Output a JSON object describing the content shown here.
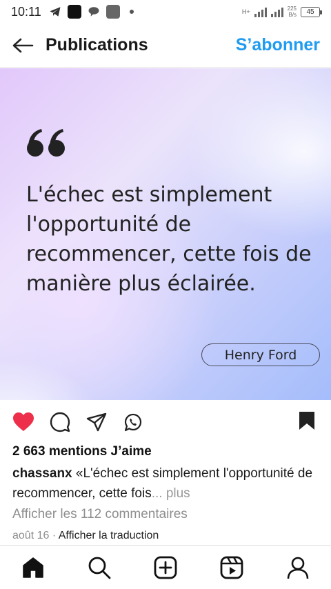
{
  "status_bar": {
    "time": "10:11",
    "network_type": "H+",
    "speed_value": "225",
    "speed_unit": "B/s",
    "battery": "45",
    "icons": [
      "telegram-icon",
      "app-icon",
      "chat-bubble-icon",
      "app-icon",
      "notification-dot-icon",
      "signal-icon",
      "battery-icon"
    ]
  },
  "header": {
    "title": "Publications",
    "subscribe_label": "S’abonner",
    "accent_color": "#1f9bf0"
  },
  "post": {
    "quote_text": "L'échec est simplement l'opportunité de recommencer, cette fois de manière plus éclairée.",
    "author": "Henry Ford"
  },
  "actions": {
    "icons": [
      "heart-filled-icon",
      "comment-icon",
      "share-icon",
      "whatsapp-icon",
      "bookmark-icon"
    ],
    "like_color": "#ed2f4c"
  },
  "caption": {
    "likes": "2 663 mentions J’aime",
    "username": "chassanx",
    "text": " «L'échec est simplement l'opportunité de recommencer, cette fois",
    "more": "... plus",
    "comments_link": "Afficher les 112 commentaires",
    "date": "août 16",
    "separator": " · ",
    "translate": "Afficher la traduction"
  },
  "bottom_nav": {
    "items": [
      "home-icon",
      "search-icon",
      "create-icon",
      "reels-icon",
      "profile-icon"
    ]
  }
}
